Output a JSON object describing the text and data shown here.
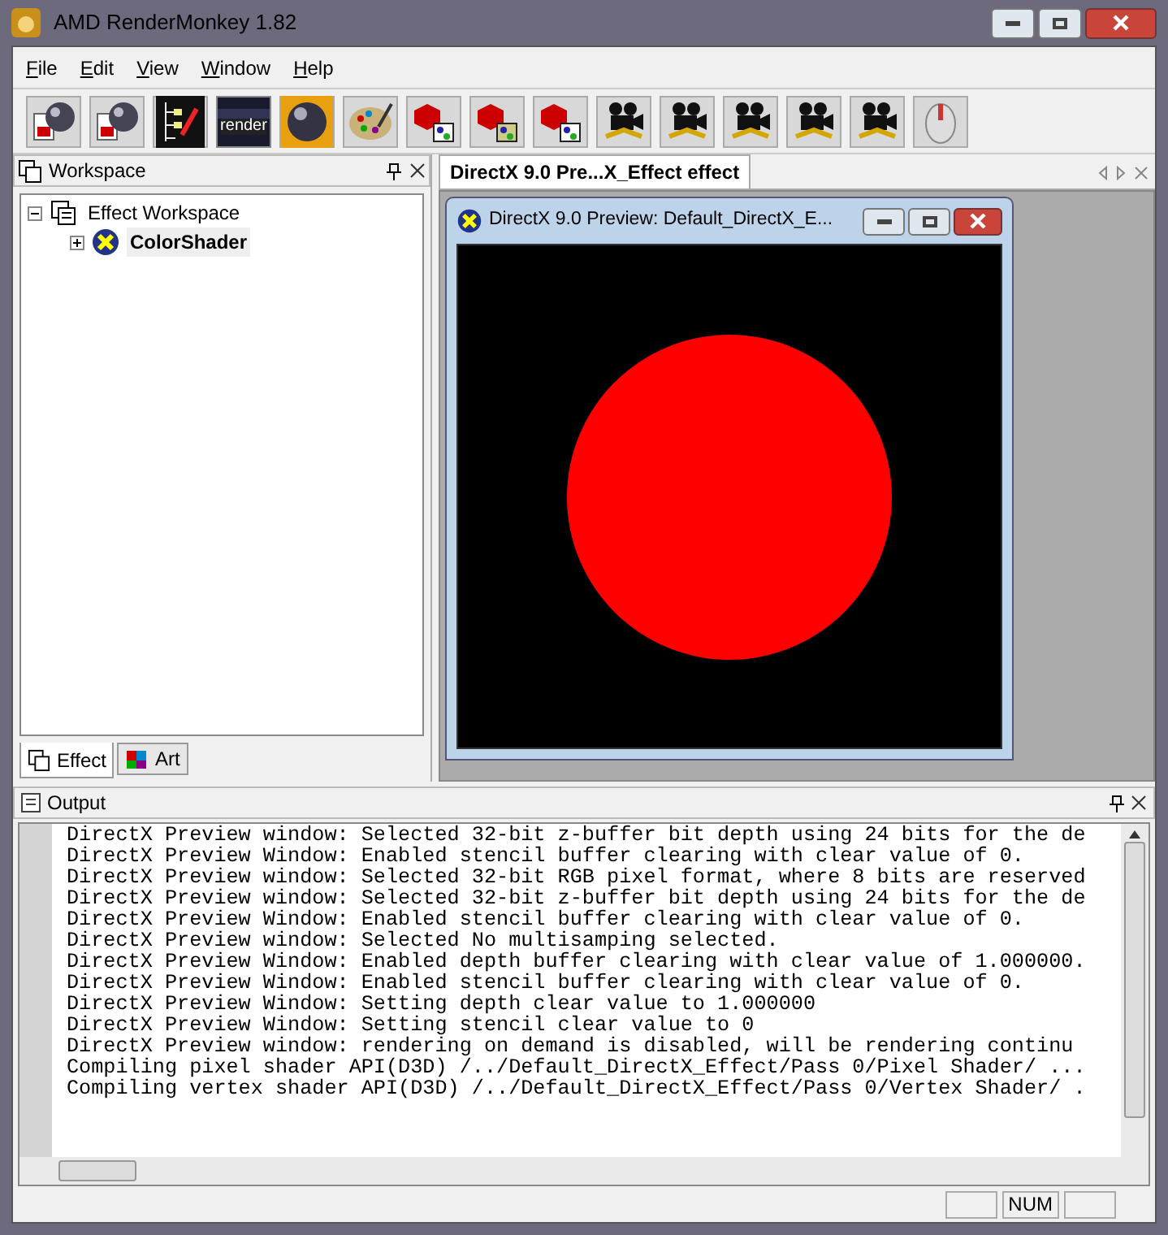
{
  "window": {
    "title": "AMD RenderMonkey 1.82"
  },
  "menu": [
    "File",
    "Edit",
    "View",
    "Window",
    "Help"
  ],
  "toolbar": [
    {
      "kind": "sphere-doc"
    },
    {
      "kind": "sphere-doc"
    },
    {
      "kind": "tree"
    },
    {
      "kind": "render",
      "label": "render"
    },
    {
      "kind": "sphere"
    },
    {
      "kind": "palette"
    },
    {
      "kind": "red-nodes"
    },
    {
      "kind": "red-gl"
    },
    {
      "kind": "red-windows"
    },
    {
      "kind": "camera"
    },
    {
      "kind": "camera"
    },
    {
      "kind": "camera"
    },
    {
      "kind": "camera"
    },
    {
      "kind": "camera"
    },
    {
      "kind": "mouse"
    }
  ],
  "workspace": {
    "title": "Workspace",
    "tree": [
      {
        "label": "Effect Workspace",
        "expanded": true,
        "bold": false,
        "children": [
          {
            "label": "ColorShader",
            "expanded": false,
            "bold": true
          }
        ]
      }
    ],
    "tabs": [
      {
        "label": "Effect",
        "selected": true
      },
      {
        "label": "Art",
        "selected": false
      }
    ]
  },
  "document_tab": {
    "label": "DirectX 9.0 Pre...X_Effect effect"
  },
  "preview": {
    "title": "DirectX 9.0 Preview: Default_DirectX_E..."
  },
  "output": {
    "title": "Output",
    "lines": [
      "DirectX Preview window: Selected 32-bit z-buffer bit depth using 24 bits for the de",
      "DirectX Preview Window: Enabled stencil buffer clearing with clear value of 0.",
      "DirectX Preview window: Selected 32-bit RGB pixel format, where 8 bits are reserved",
      "DirectX Preview window: Selected 32-bit z-buffer bit depth using 24 bits for the de",
      "DirectX Preview Window: Enabled stencil buffer clearing with clear value of 0.",
      "DirectX Preview window: Selected No multisamping selected.",
      "DirectX Preview Window: Enabled depth buffer clearing with clear value of 1.000000.",
      "DirectX Preview Window: Enabled stencil buffer clearing with clear value of 0.",
      "DirectX Preview Window: Setting depth clear value to 1.000000",
      "DirectX Preview Window: Setting stencil clear value to 0",
      "DirectX Preview window: rendering on demand is disabled, will be rendering continu",
      "Compiling pixel shader API(D3D) /../Default_DirectX_Effect/Pass 0/Pixel Shader/ ...",
      "Compiling vertex shader API(D3D) /../Default_DirectX_Effect/Pass 0/Vertex Shader/ ."
    ]
  },
  "status_bar": {
    "num_indicator": "NUM"
  }
}
